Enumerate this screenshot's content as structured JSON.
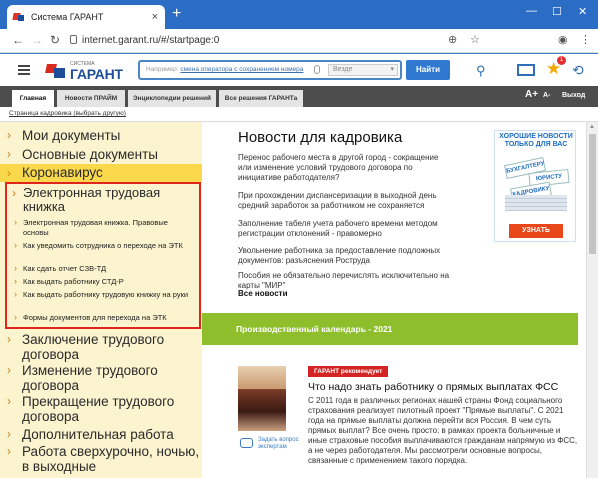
{
  "browser": {
    "tab_title": "Система ГАРАНТ",
    "tab_close": "×",
    "new_tab": "+",
    "url": "internet.garant.ru/#/startpage:0",
    "controls": {
      "minimize": "—",
      "maximize": "☐",
      "close": "✕"
    }
  },
  "header": {
    "logo_small": "СИСТЕМА",
    "logo_big": "ГАРАНТ",
    "search_hint_prefix": "Например:",
    "search_hint_link": "смена оператора с сохранением номера",
    "search_scope": "Везде",
    "search_button": "Найти",
    "notification_count": "1"
  },
  "tabs": [
    {
      "label": "Главная",
      "active": true
    },
    {
      "label": "Новости ПРАЙМ",
      "active": false
    },
    {
      "label": "Энциклопедии решений",
      "active": false
    },
    {
      "label": "Все решения ГАРАНТа",
      "active": false
    }
  ],
  "font_controls": {
    "increase": "A+",
    "decrease": "A-"
  },
  "exit_label": "Выход",
  "breadcrumb": "Страница кадровика (выбрать другую)",
  "sidebar": {
    "top_items": [
      "Мои документы",
      "Основные документы"
    ],
    "highlighted_item": "Коронавирус",
    "expanded": {
      "heading": "Электронная трудовая книжка",
      "links": [
        "Электронная трудовая книжка. Правовые основы",
        "Как уведомить сотрудника о переходе на ЭТК",
        "Как сдать отчет СЗВ-ТД",
        "Как выдать работнику СТД-Р",
        "Как выдать работнику трудовую книжку на руки",
        "Формы документов для перехода на ЭТК"
      ]
    },
    "bottom_items": [
      "Заключение трудового договора",
      "Изменение трудового договора",
      "Прекращение трудового договора",
      "Дополнительная работа",
      "Работа сверхурочно, ночью, в выходные"
    ]
  },
  "news": {
    "title": "Новости для кадровика",
    "items": [
      "Перенос рабочего места в другой город - сокращение или изменение условий трудового договора по инициативе работодателя?",
      "При прохождении диспансеризации в выходной день средний заработок за работником не сохраняется",
      "Заполнение табеля учета рабочего времени методом регистрации отклонений - правомерно",
      "Увольнение работника за предоставление подложных документов: разъяснения Роструда",
      "Пособия не обязательно перечислять исключительно на карты \"МИР\""
    ],
    "all_news": "Все новости"
  },
  "promo": {
    "title": "ХОРОШИЕ НОВОСТИ ТОЛЬКО ДЛЯ ВАС",
    "papers": [
      "БУХГАЛТЕРУ",
      "ЮРИСТУ",
      "КАДРОВИКУ"
    ],
    "button": "УЗНАТЬ"
  },
  "calendar": {
    "label": "Производственный календарь - 2021"
  },
  "article": {
    "badge": "ГАРАНТ рекомендует",
    "title": "Что надо знать работнику о прямых выплатах ФСС",
    "body": "С 2011 года в различных регионах нашей страны Фонд социального страхования реализует пилотный проект \"Прямые выплаты\". С 2021 года на прямые выплаты должна перейти вся Россия. В чем суть прямых выплат? Все очень просто: в рамках проекта больничные и иные страховые пособия выплачиваются гражданам напрямую из ФСС, а не через работодателя. Мы рассмотрели основные вопросы, связанные с применением такого порядка.",
    "ask_expert": "Задать вопрос экспертам"
  }
}
